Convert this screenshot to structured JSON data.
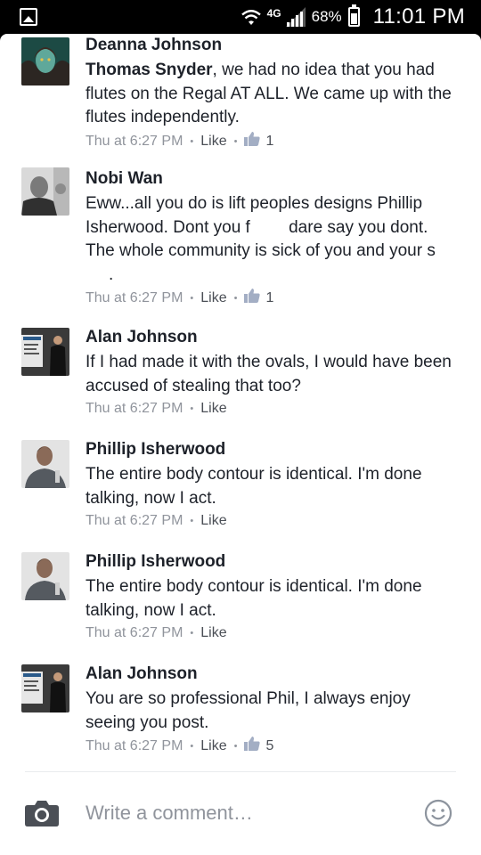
{
  "status_bar": {
    "network": "4G",
    "battery": "68%",
    "battery_level": 0.68,
    "time": "11:01 PM"
  },
  "comments": [
    {
      "author": "Deanna Johnson",
      "mention": "Thomas Snyder",
      "text": ", we had no idea that you had flutes on the Regal AT ALL.  We came up with the flutes independently.",
      "time": "Thu at 6:27 PM",
      "like_label": "Like",
      "likes": "1"
    },
    {
      "author": "Nobi Wan",
      "text_a": "Eww...all you do is lift peoples designs Phillip Isherwood.  Dont you f",
      "text_b": " dare say you dont. The whole community is sick of you and your s",
      "text_c": ".",
      "time": "Thu at 6:27 PM",
      "like_label": "Like",
      "likes": "1"
    },
    {
      "author": "Alan Johnson",
      "text": "If I had made it with the ovals, I would have been accused of stealing that too?",
      "time": "Thu at 6:27 PM",
      "like_label": "Like"
    },
    {
      "author": "Phillip Isherwood",
      "text": "The entire body contour is identical. I'm done talking, now I act.",
      "time": "Thu at 6:27 PM",
      "like_label": "Like"
    },
    {
      "author": "Phillip Isherwood",
      "text": "The entire body contour is identical. I'm done talking, now I act.",
      "time": "Thu at 6:27 PM",
      "like_label": "Like"
    },
    {
      "author": "Alan Johnson",
      "text": "You are so professional Phil, I always enjoy seeing you post.",
      "time": "Thu at 6:27 PM",
      "like_label": "Like",
      "likes": "5"
    }
  ],
  "composer": {
    "placeholder": "Write a comment…"
  },
  "colors": {
    "meta": "#90949c",
    "name": "#1d2129",
    "like_thumb": "#a3aec4"
  }
}
